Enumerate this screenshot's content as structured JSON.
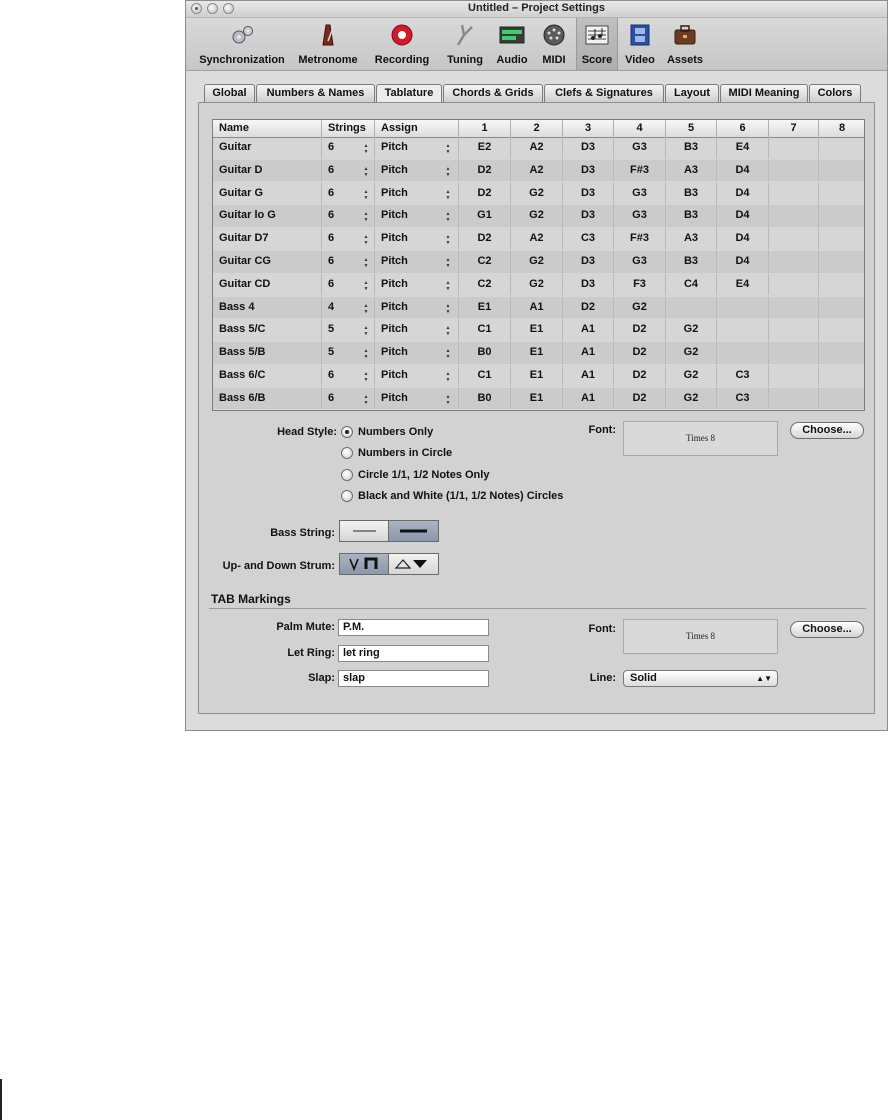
{
  "window": {
    "title": "Untitled – Project Settings"
  },
  "toolbar": {
    "items": [
      {
        "label": "Synchronization",
        "icon": "gears-icon"
      },
      {
        "label": "Metronome",
        "icon": "metronome-icon"
      },
      {
        "label": "Recording",
        "icon": "record-icon"
      },
      {
        "label": "Tuning",
        "icon": "tuning-fork-icon"
      },
      {
        "label": "Audio",
        "icon": "audio-meter-icon"
      },
      {
        "label": "MIDI",
        "icon": "midi-port-icon"
      },
      {
        "label": "Score",
        "icon": "score-icon",
        "selected": true
      },
      {
        "label": "Video",
        "icon": "film-icon"
      },
      {
        "label": "Assets",
        "icon": "briefcase-icon"
      }
    ]
  },
  "tabs": [
    "Global",
    "Numbers & Names",
    "Tablature",
    "Chords & Grids",
    "Clefs & Signatures",
    "Layout",
    "MIDI Meaning",
    "Colors"
  ],
  "selected_tab": "Tablature",
  "table": {
    "headers": [
      "Name",
      "Strings",
      "Assign",
      "1",
      "2",
      "3",
      "4",
      "5",
      "6",
      "7",
      "8"
    ],
    "rows": [
      {
        "name": "Guitar",
        "strings": "6",
        "assign": "Pitch",
        "notes": [
          "E2",
          "A2",
          "D3",
          "G3",
          "B3",
          "E4",
          "",
          ""
        ]
      },
      {
        "name": "Guitar D",
        "strings": "6",
        "assign": "Pitch",
        "notes": [
          "D2",
          "A2",
          "D3",
          "F#3",
          "A3",
          "D4",
          "",
          ""
        ]
      },
      {
        "name": "Guitar G",
        "strings": "6",
        "assign": "Pitch",
        "notes": [
          "D2",
          "G2",
          "D3",
          "G3",
          "B3",
          "D4",
          "",
          ""
        ]
      },
      {
        "name": "Guitar lo G",
        "strings": "6",
        "assign": "Pitch",
        "notes": [
          "G1",
          "G2",
          "D3",
          "G3",
          "B3",
          "D4",
          "",
          ""
        ]
      },
      {
        "name": "Guitar D7",
        "strings": "6",
        "assign": "Pitch",
        "notes": [
          "D2",
          "A2",
          "C3",
          "F#3",
          "A3",
          "D4",
          "",
          ""
        ]
      },
      {
        "name": "Guitar CG",
        "strings": "6",
        "assign": "Pitch",
        "notes": [
          "C2",
          "G2",
          "D3",
          "G3",
          "B3",
          "D4",
          "",
          ""
        ]
      },
      {
        "name": "Guitar CD",
        "strings": "6",
        "assign": "Pitch",
        "notes": [
          "C2",
          "G2",
          "D3",
          "F3",
          "C4",
          "E4",
          "",
          ""
        ]
      },
      {
        "name": "Bass 4",
        "strings": "4",
        "assign": "Pitch",
        "notes": [
          "E1",
          "A1",
          "D2",
          "G2",
          "",
          "",
          "",
          ""
        ]
      },
      {
        "name": "Bass 5/C",
        "strings": "5",
        "assign": "Pitch",
        "notes": [
          "C1",
          "E1",
          "A1",
          "D2",
          "G2",
          "",
          "",
          ""
        ]
      },
      {
        "name": "Bass 5/B",
        "strings": "5",
        "assign": "Pitch",
        "notes": [
          "B0",
          "E1",
          "A1",
          "D2",
          "G2",
          "",
          "",
          ""
        ]
      },
      {
        "name": "Bass 6/C",
        "strings": "6",
        "assign": "Pitch",
        "notes": [
          "C1",
          "E1",
          "A1",
          "D2",
          "G2",
          "C3",
          "",
          ""
        ]
      },
      {
        "name": "Bass 6/B",
        "strings": "6",
        "assign": "Pitch",
        "notes": [
          "B0",
          "E1",
          "A1",
          "D2",
          "G2",
          "C3",
          "",
          ""
        ]
      }
    ]
  },
  "head_style": {
    "label": "Head Style:",
    "options": [
      "Numbers Only",
      "Numbers in Circle",
      "Circle 1/1, 1/2 Notes Only",
      "Black and White (1/1, 1/2 Notes) Circles"
    ],
    "selected": "Numbers Only"
  },
  "font1": {
    "label": "Font:",
    "value": "Times 8",
    "button": "Choose..."
  },
  "bass_string": {
    "label": "Bass String:",
    "selected": "thick"
  },
  "strum": {
    "label": "Up- and Down Strum:",
    "selected": "down-up"
  },
  "tab_markings": {
    "title": "TAB Markings",
    "palm_mute": {
      "label": "Palm Mute:",
      "value": "P.M."
    },
    "let_ring": {
      "label": "Let Ring:",
      "value": "let ring"
    },
    "slap": {
      "label": "Slap:",
      "value": "slap"
    },
    "font": {
      "label": "Font:",
      "value": "Times 8",
      "button": "Choose..."
    },
    "line": {
      "label": "Line:",
      "value": "Solid"
    }
  }
}
